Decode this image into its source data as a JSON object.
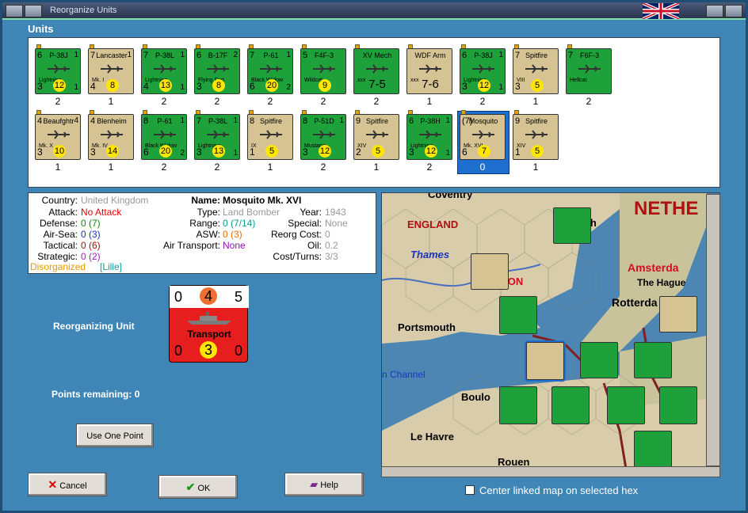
{
  "window": {
    "title": "Reorganize Units"
  },
  "units_section": {
    "label": "Units"
  },
  "row1": [
    {
      "name": "P-38J",
      "tl": "6",
      "tr": "1",
      "bl": "3",
      "badge": "12",
      "br": "1",
      "sub": "Lightning",
      "count": "2",
      "color": "green"
    },
    {
      "name": "Lancaster",
      "tl": "7",
      "tr": "1",
      "bl": "4",
      "badge": "8",
      "br": "",
      "sub": "Mk. I",
      "count": "1",
      "color": "tan"
    },
    {
      "name": "P-38L",
      "tl": "7",
      "tr": "1",
      "bl": "4",
      "badge": "13",
      "br": "1",
      "sub": "Lightning",
      "count": "2",
      "color": "green"
    },
    {
      "name": "B-17F",
      "tl": "6",
      "tr": "2",
      "bl": "3",
      "badge": "8",
      "br": "",
      "sub": "Flying Fort",
      "count": "2",
      "color": "green"
    },
    {
      "name": "P-61",
      "tl": "7",
      "tr": "1",
      "bl": "6",
      "badge": "20",
      "br": "2",
      "sub": "Black Widow",
      "count": "2",
      "color": "green"
    },
    {
      "name": "F4F-3",
      "tl": "5",
      "tr": "",
      "bl": "",
      "badge": "9",
      "br": "",
      "sub": "Wildcat",
      "count": "2",
      "color": "green"
    },
    {
      "name": "XV Mech",
      "tl": "",
      "tr": "",
      "bl": "",
      "badge": "",
      "br": "",
      "sub": "xxx",
      "big": "7-5",
      "count": "2",
      "color": "green"
    },
    {
      "name": "WDF Arm",
      "tl": "",
      "tr": "",
      "bl": "",
      "badge": "",
      "br": "",
      "sub": "xxx",
      "big": "7-6",
      "count": "1",
      "color": "tan"
    },
    {
      "name": "P-38J",
      "tl": "6",
      "tr": "1",
      "bl": "3",
      "badge": "12",
      "br": "1",
      "sub": "Lightning",
      "count": "2",
      "color": "green"
    },
    {
      "name": "Spitfire",
      "tl": "7",
      "tr": "",
      "bl": "3",
      "badge": "5",
      "br": "",
      "sub": "VIII",
      "count": "1",
      "color": "tan"
    },
    {
      "name": "F6F-3",
      "tl": "7",
      "tr": "",
      "bl": "",
      "badge": "",
      "br": "",
      "sub": "Hellcat",
      "count": "2",
      "color": "green"
    }
  ],
  "row2": [
    {
      "name": "Beaufghtr",
      "tl": "4",
      "tr": "4",
      "bl": "3",
      "badge": "10",
      "br": "",
      "sub": "Mk. X",
      "count": "1",
      "color": "tan"
    },
    {
      "name": "Blenheim",
      "tl": "4",
      "tr": "",
      "bl": "3",
      "badge": "14",
      "br": "",
      "sub": "Mk. IV",
      "count": "1",
      "color": "tan"
    },
    {
      "name": "P-61",
      "tl": "8",
      "tr": "1",
      "bl": "6",
      "badge": "20",
      "br": "2",
      "sub": "Black Widow",
      "count": "2",
      "color": "green"
    },
    {
      "name": "P-38L",
      "tl": "7",
      "tr": "1",
      "bl": "3",
      "badge": "13",
      "br": "1",
      "sub": "Lightning",
      "count": "2",
      "color": "green"
    },
    {
      "name": "Spitfire",
      "tl": "8",
      "tr": "",
      "bl": "1",
      "badge": "5",
      "br": "",
      "sub": "IX",
      "count": "1",
      "color": "tan"
    },
    {
      "name": "P-51D",
      "tl": "8",
      "tr": "1",
      "bl": "3",
      "badge": "12",
      "br": "",
      "sub": "Mustang",
      "count": "2",
      "color": "green"
    },
    {
      "name": "Spitfire",
      "tl": "9",
      "tr": "",
      "bl": "2",
      "badge": "5",
      "br": "",
      "sub": "XIV",
      "count": "1",
      "color": "tan"
    },
    {
      "name": "P-38H",
      "tl": "6",
      "tr": "1",
      "bl": "3",
      "badge": "12",
      "br": "1",
      "sub": "Lightning",
      "count": "2",
      "color": "green"
    },
    {
      "name": "Mosquito",
      "tl": "(7)",
      "tr": "",
      "bl": "6",
      "badge": "7",
      "br": "",
      "sub": "Mk. XVI",
      "count": "0",
      "color": "tan",
      "selected": true
    },
    {
      "name": "Spitfire",
      "tl": "9",
      "tr": "",
      "bl": "1",
      "badge": "5",
      "br": "",
      "sub": "XIV",
      "count": "1",
      "color": "tan"
    }
  ],
  "info": {
    "country_label": "Country:",
    "country": "United Kingdom",
    "attack_label": "Attack:",
    "attack": "No Attack",
    "defense_label": "Defense:",
    "defense": "0 (7)",
    "airsea_label": "Air-Sea:",
    "airsea": "0 (3)",
    "tactical_label": "Tactical:",
    "tactical": "0 (6)",
    "strategic_label": "Strategic:",
    "strategic": "0 (2)",
    "status": "Disorganized",
    "status_loc": "[Lille]",
    "name_label": "Name:",
    "name": "Mosquito Mk. XVI",
    "type_label": "Type:",
    "type": "Land Bomber",
    "year_label": "Year:",
    "year": "1943",
    "range_label": "Range:",
    "range": "0 (7/14)",
    "special_label": "Special:",
    "special": "None",
    "asw_label": "ASW:",
    "asw": "0 (3)",
    "reorg_label": "Reorg Cost:",
    "reorg": "0",
    "airtrans_label": "Air Transport:",
    "airtrans": "None",
    "oil_label": "Oil:",
    "oil": "0.2",
    "cost_label": "Cost/Turns:",
    "cost": "3/3"
  },
  "reorganizing": {
    "label": "Reorganizing Unit",
    "top_left": "0",
    "top_mid": "4",
    "top_right": "5",
    "name": "Transport",
    "bot_left": "0",
    "bot_mid": "3",
    "bot_right": "0"
  },
  "points": {
    "label": "Points remaining:",
    "value": "0"
  },
  "buttons": {
    "use_one_point": "Use One Point",
    "cancel": "Cancel",
    "ok": "OK",
    "help": "Help"
  },
  "map": {
    "labels": {
      "england": "ENGLAND",
      "thames": "Thames",
      "portsmouth": "Portsmouth",
      "channel": "n Channel",
      "boulogne": "Boulo",
      "lehavre": "Le Havre",
      "rouen": "Rouen",
      "neth": "NETHE",
      "amsterdam": "Amsterda",
      "hague": "The Hague",
      "rotterdam": "Rotterda",
      "coventry": "Coventry",
      "london": "NDON",
      "ich": "ich"
    },
    "checkbox_label": "Center linked map on selected hex"
  },
  "colors": {
    "panel_bg": "#3f86b6",
    "counter_green": "#1ea13a",
    "counter_tan": "#d6c394",
    "selected": "#1e6fd0",
    "transport_red": "#e61e1e"
  }
}
